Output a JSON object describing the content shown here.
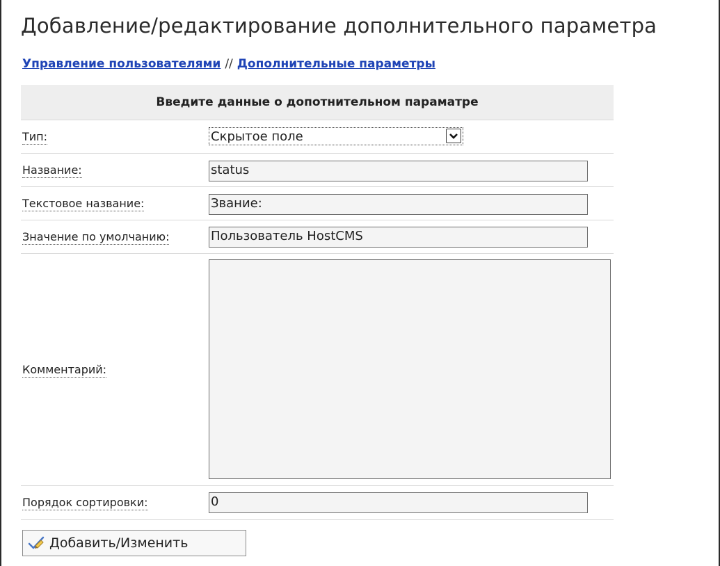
{
  "page": {
    "title": "Добавление/редактирование дополнительного параметра",
    "breadcrumb": {
      "users_link": "Управление пользователями",
      "separator": "//",
      "params_link": "Дополнительные параметры"
    }
  },
  "form": {
    "header": "Введите данные о допотнительном параматре",
    "fields": {
      "type": {
        "label": "Тип:",
        "value": "Скрытое поле"
      },
      "name": {
        "label": "Название:",
        "value": "status"
      },
      "text_name": {
        "label": "Текстовое название:",
        "value": "Звание:"
      },
      "default_value": {
        "label": "Значение по умолчанию:",
        "value": "Пользователь HostCMS"
      },
      "comment": {
        "label": "Комментарий:",
        "value": ""
      },
      "sort_order": {
        "label": "Порядок сортировки:",
        "value": "0"
      }
    },
    "submit_label": "Добавить/Изменить"
  },
  "icons": {
    "submit": "pencil-check-icon",
    "select_arrow": "chevron-down-icon"
  }
}
